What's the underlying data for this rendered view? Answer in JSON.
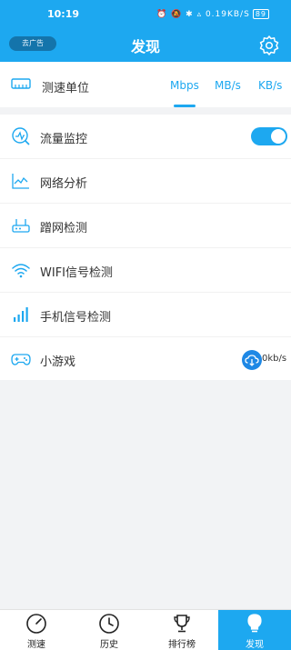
{
  "status_bar": {
    "time": "10:19",
    "icons": "⏰ 🔕 ✱ ▵ 0.19KB/S",
    "battery": "89"
  },
  "header": {
    "ad_label": "去广告",
    "title": "发现"
  },
  "unit_selector": {
    "label": "测速单位",
    "options": [
      "Mbps",
      "MB/s",
      "KB/s"
    ],
    "selected": "Mbps"
  },
  "features": [
    {
      "label": "流量监控",
      "icon": "traffic-monitor-icon",
      "toggle_on": true
    },
    {
      "label": "网络分析",
      "icon": "network-analysis-icon"
    },
    {
      "label": "蹭网检测",
      "icon": "router-icon"
    },
    {
      "label": "WIFI信号检测",
      "icon": "wifi-icon"
    },
    {
      "label": "手机信号检测",
      "icon": "cellular-signal-icon"
    },
    {
      "label": "小游戏",
      "icon": "gamepad-icon",
      "speed": "0kb/s"
    }
  ],
  "tabs": [
    {
      "label": "测速",
      "icon": "speedometer-icon"
    },
    {
      "label": "历史",
      "icon": "clock-icon"
    },
    {
      "label": "排行榜",
      "icon": "trophy-icon"
    },
    {
      "label": "发现",
      "icon": "lightbulb-icon",
      "active": true
    }
  ],
  "colors": {
    "accent": "#1da8f0",
    "ad_button": "#1474ab"
  }
}
